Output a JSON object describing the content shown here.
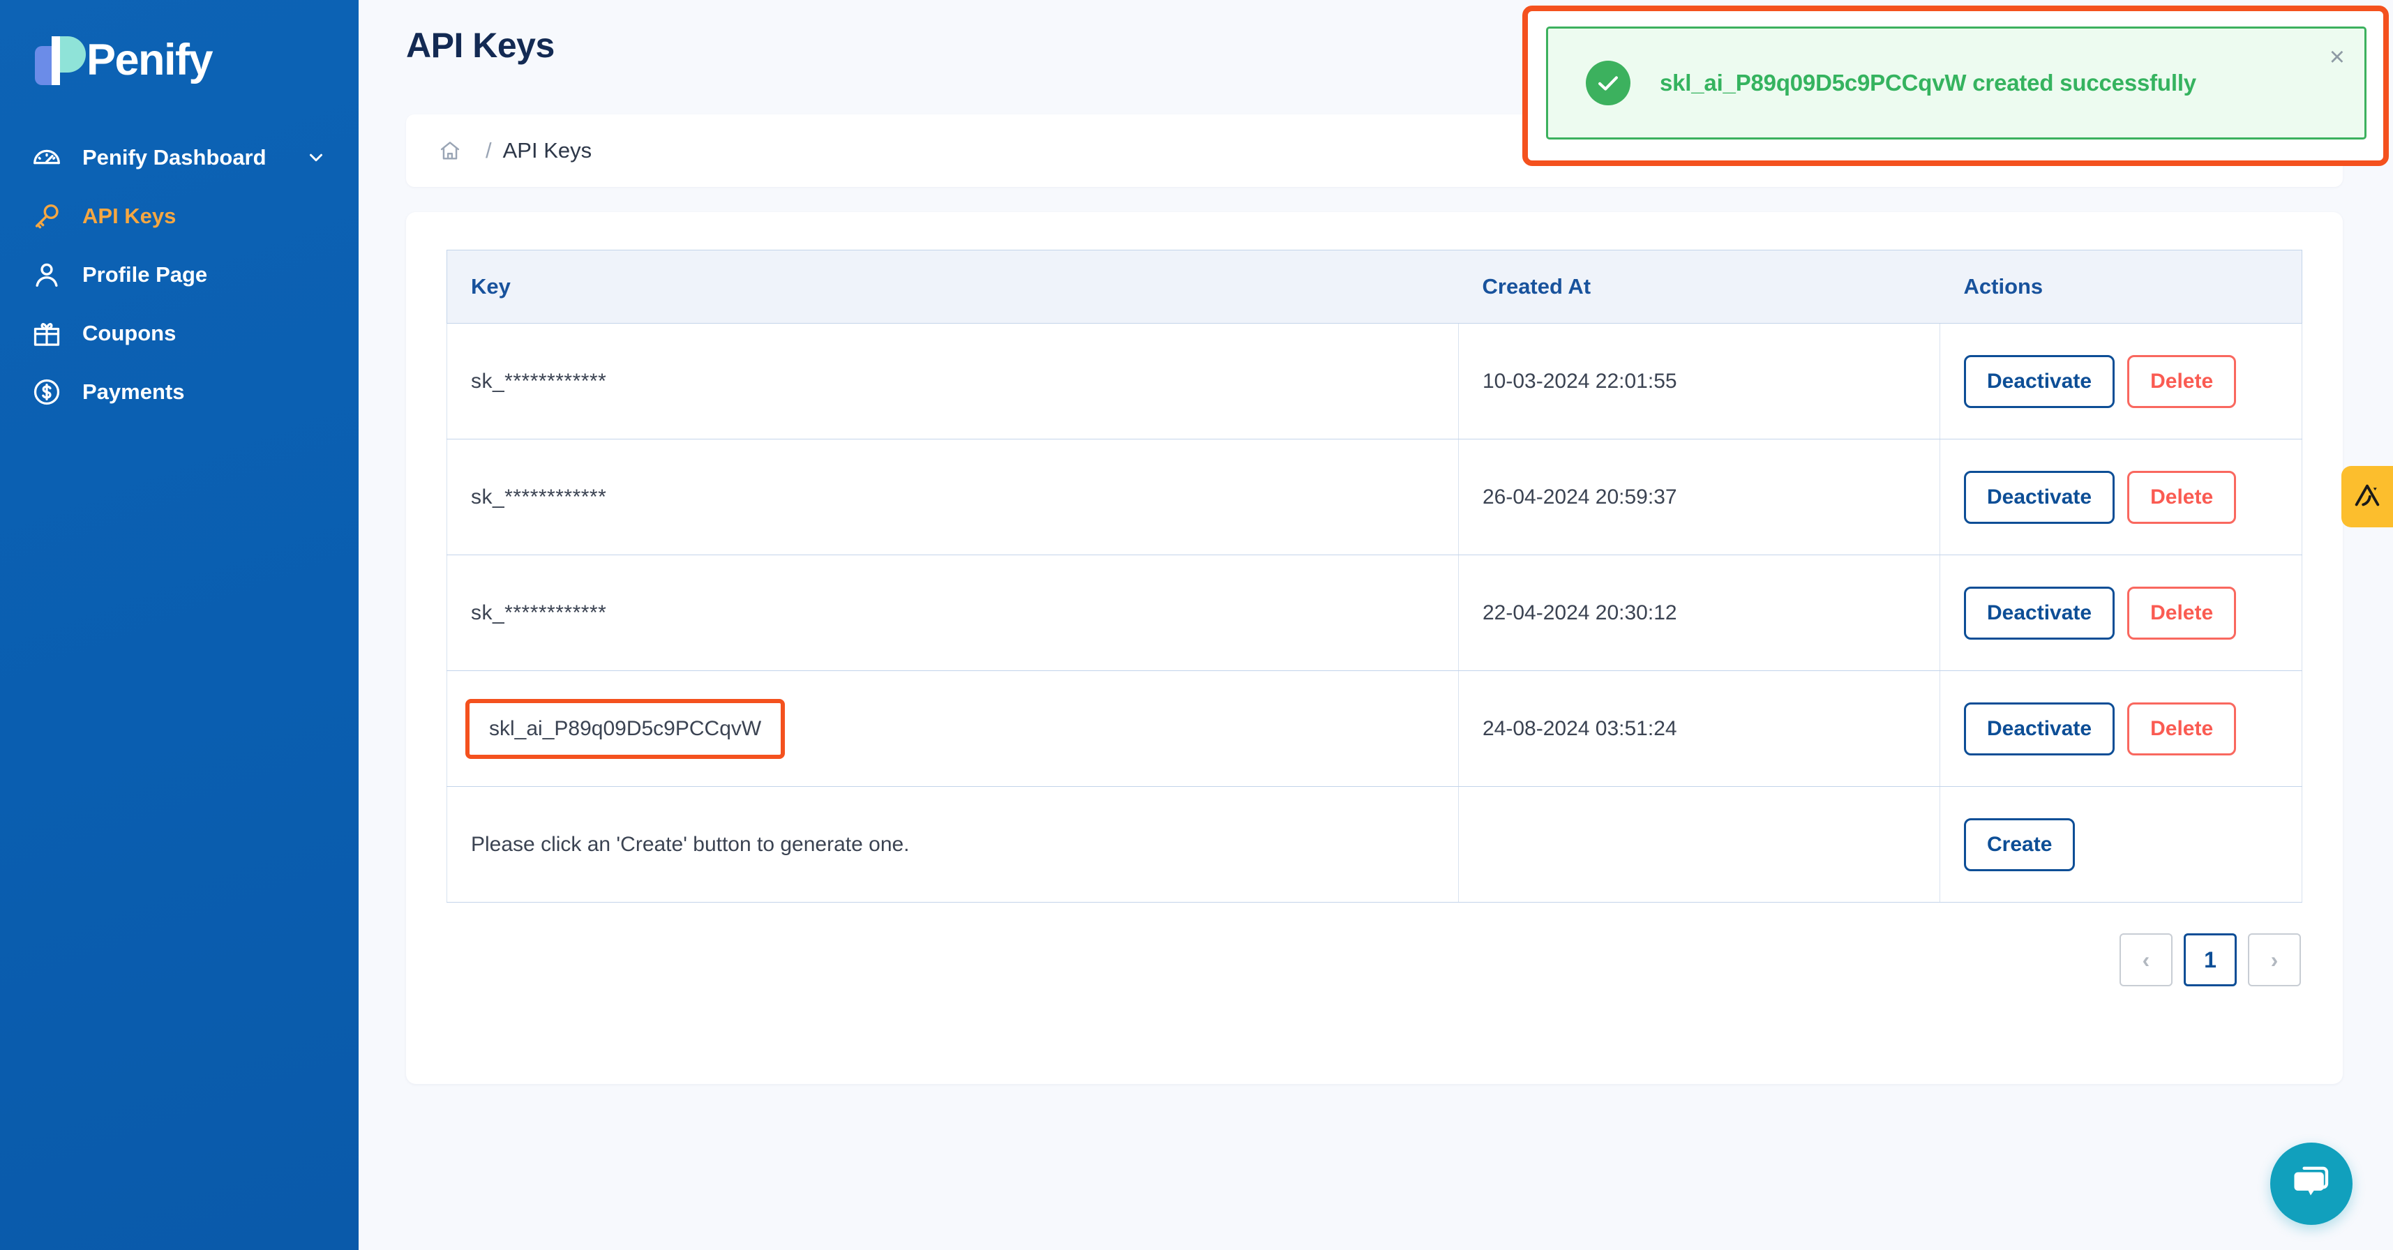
{
  "brand": {
    "name": "Penify",
    "logo_initial": "P"
  },
  "sidebar": {
    "items": [
      {
        "label": "Penify Dashboard",
        "icon": "gauge-icon",
        "active": false,
        "expandable": true
      },
      {
        "label": "API Keys",
        "icon": "key-icon",
        "active": true,
        "expandable": false
      },
      {
        "label": "Profile Page",
        "icon": "user-icon",
        "active": false,
        "expandable": false
      },
      {
        "label": "Coupons",
        "icon": "gift-icon",
        "active": false,
        "expandable": false
      },
      {
        "label": "Payments",
        "icon": "dollar-circle-icon",
        "active": false,
        "expandable": false
      }
    ]
  },
  "header": {
    "title": "API Keys"
  },
  "breadcrumb": {
    "home_icon": "home-icon",
    "separator": "/",
    "current": "API Keys"
  },
  "toast": {
    "icon": "check-circle-icon",
    "message": "skl_ai_P89q09D5c9PCCqvW created successfully",
    "close_label": "×",
    "accent": "#3cb15e",
    "bg": "#edfbf0",
    "annotation_color": "#f4511e"
  },
  "table": {
    "columns": [
      "Key",
      "Created At",
      "Actions"
    ],
    "rows": [
      {
        "key": "sk_************",
        "created_at": "10-03-2024 22:01:55",
        "actions": [
          "Deactivate",
          "Delete"
        ],
        "highlighted": false
      },
      {
        "key": "sk_************",
        "created_at": "26-04-2024 20:59:37",
        "actions": [
          "Deactivate",
          "Delete"
        ],
        "highlighted": false
      },
      {
        "key": "sk_************",
        "created_at": "22-04-2024 20:30:12",
        "actions": [
          "Deactivate",
          "Delete"
        ],
        "highlighted": false
      },
      {
        "key": "skl_ai_P89q09D5c9PCCqvW",
        "created_at": "24-08-2024 03:51:24",
        "actions": [
          "Deactivate",
          "Delete"
        ],
        "highlighted": true
      }
    ],
    "create_row": {
      "message": "Please click an 'Create' button to generate one.",
      "created_at": "",
      "action": "Create"
    }
  },
  "pagination": {
    "prev": "‹",
    "pages": [
      "1"
    ],
    "current": "1",
    "next": "›"
  },
  "floating": {
    "side_tab": {
      "icon": "apex-logo-icon",
      "color": "#fcbe2d"
    },
    "chat": {
      "icon": "chat-bubbles-icon",
      "color": "#11a0bd"
    }
  },
  "colors": {
    "sidebar_blue": "#0a5eb0",
    "accent_orange": "#f5a742",
    "primary_blue": "#0d4e96",
    "danger_red": "#fa5b52",
    "success_green": "#3cb15e",
    "page_bg": "#f7f9fd",
    "table_header_bg": "#eff3fa"
  }
}
